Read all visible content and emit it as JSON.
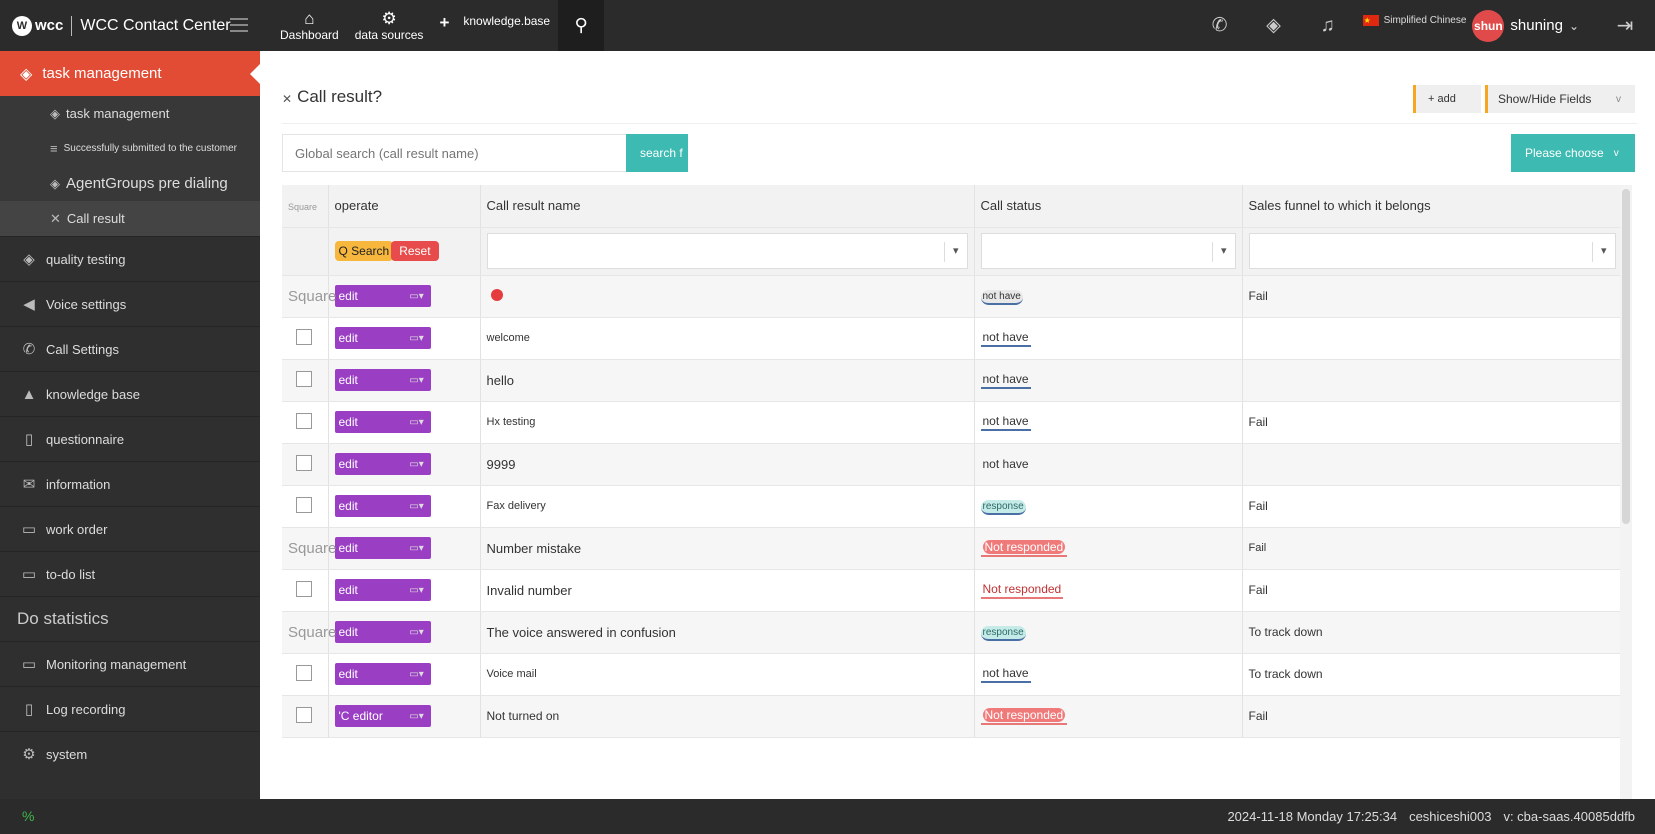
{
  "topbar": {
    "logo": "wcc",
    "title": "WCC Contact Center",
    "nav": [
      {
        "label": "Dashboard",
        "icon": "home-icon"
      },
      {
        "label": "data sources",
        "icon": "gears-icon"
      }
    ],
    "kb_label": "knowledge.base",
    "lang": "Simplified Chinese",
    "avatar": "shun",
    "username": "shuning"
  },
  "sidebar": {
    "active": "task management",
    "sub_items": [
      {
        "label": "task management"
      },
      {
        "label": "Successfully submitted to the customer"
      },
      {
        "label": "AgentGroups pre dialing"
      },
      {
        "label": "Call result"
      }
    ],
    "items": [
      {
        "label": "quality testing",
        "icon": "layers-icon"
      },
      {
        "label": "Voice settings",
        "icon": "speaker-icon"
      },
      {
        "label": "Call Settings",
        "icon": "phone-icon"
      },
      {
        "label": "knowledge base",
        "icon": "graduation-cap-icon"
      },
      {
        "label": "questionnaire",
        "icon": "document-icon"
      },
      {
        "label": "information",
        "icon": "envelope-icon"
      },
      {
        "label": "work order",
        "icon": "folder-icon"
      },
      {
        "label": "to-do list",
        "icon": "folder-icon"
      }
    ],
    "heading": "Do statistics",
    "items2": [
      {
        "label": "Monitoring management",
        "icon": "monitor-icon"
      },
      {
        "label": "Log recording",
        "icon": "notebook-icon"
      },
      {
        "label": "system",
        "icon": "gear-icon"
      }
    ]
  },
  "main": {
    "title": "Call result?",
    "add_label": "add",
    "fields_label": "Show/Hide Fields",
    "fields_caret": "v",
    "search_placeholder": "Global search (call result name)",
    "search_label": "search f",
    "choose_label": "Please choose",
    "choose_caret": "v"
  },
  "table": {
    "headers": {
      "square": "Square",
      "operate": "operate",
      "name": "Call result name",
      "status": "Call status",
      "funnel": "Sales funnel to which it belongs"
    },
    "q_search": "Q Search",
    "reset": "Reset",
    "rows": [
      {
        "square": "Square",
        "op": "edit",
        "name": "",
        "status": "not have",
        "funnel": "Fail"
      },
      {
        "square": "",
        "op": "edit",
        "name": "welcome",
        "status": "not have",
        "funnel": ""
      },
      {
        "square": "",
        "op": "edit",
        "name": "hello",
        "status": "not have",
        "funnel": ""
      },
      {
        "square": "",
        "op": "edit",
        "name": "Hx testing",
        "status": "not have",
        "funnel": "Fail"
      },
      {
        "square": "",
        "op": "edit",
        "name": "9999",
        "status": "not have",
        "funnel": ""
      },
      {
        "square": "",
        "op": "edit",
        "name": "Fax delivery",
        "status": "response",
        "funnel": "Fail"
      },
      {
        "square": "Square",
        "op": "edit",
        "name": "Number mistake",
        "status": "Not responded",
        "funnel": "Fail"
      },
      {
        "square": "",
        "op": "edit",
        "name": "Invalid number",
        "status": "Not responded",
        "funnel": "Fail"
      },
      {
        "square": "Square",
        "op": "edit",
        "name": "The voice answered in confusion",
        "status": "response",
        "funnel": "To track down"
      },
      {
        "square": "",
        "op": "edit",
        "name": "Voice mail",
        "status": "not have",
        "funnel": "To track down"
      },
      {
        "square": "",
        "op": "'C editor",
        "name": "Not turned on",
        "status": "Not responded",
        "funnel": "Fail"
      }
    ]
  },
  "footer": {
    "datetime": "2024-11-18 Monday 17:25:34",
    "user": "ceshiceshi003",
    "version": "v: cba-saas.40085ddfb"
  }
}
